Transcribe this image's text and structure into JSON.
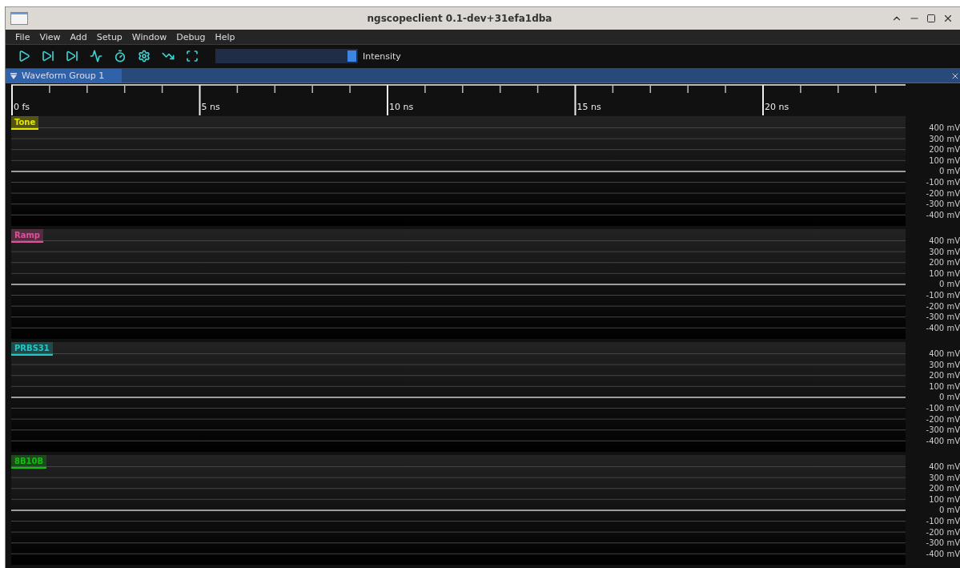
{
  "window": {
    "title": "ngscopeclient 0.1-dev+31efa1dba"
  },
  "menu": [
    "File",
    "View",
    "Add",
    "Setup",
    "Window",
    "Debug",
    "Help"
  ],
  "toolbar": {
    "intensity": {
      "label": "Intensity",
      "level": 1.0
    }
  },
  "tab": {
    "label": "Waveform Group 1",
    "selected": true
  },
  "timeline": {
    "labels": [
      "0 fs",
      "5 ns",
      "10 ns",
      "15 ns",
      "20 ns"
    ]
  },
  "channels": [
    {
      "name": "Tone",
      "color": "#e6e600",
      "axis": [
        "400 mV",
        "300 mV",
        "200 mV",
        "100 mV",
        "0 mV",
        "-100 mV",
        "-200 mV",
        "-300 mV",
        "-400 mV"
      ]
    },
    {
      "name": "Ramp",
      "color": "#e0509a",
      "axis": [
        "400 mV",
        "300 mV",
        "200 mV",
        "100 mV",
        "0 mV",
        "-100 mV",
        "-200 mV",
        "-300 mV",
        "-400 mV"
      ]
    },
    {
      "name": "PRBS31",
      "color": "#20c8c8",
      "axis": [
        "400 mV",
        "300 mV",
        "200 mV",
        "100 mV",
        "0 mV",
        "-100 mV",
        "-200 mV",
        "-300 mV",
        "-400 mV"
      ]
    },
    {
      "name": "8B10B",
      "color": "#10c010",
      "axis": [
        "400 mV",
        "300 mV",
        "200 mV",
        "100 mV",
        "0 mV",
        "-100 mV",
        "-200 mV",
        "-300 mV",
        "-400 mV"
      ]
    }
  ]
}
